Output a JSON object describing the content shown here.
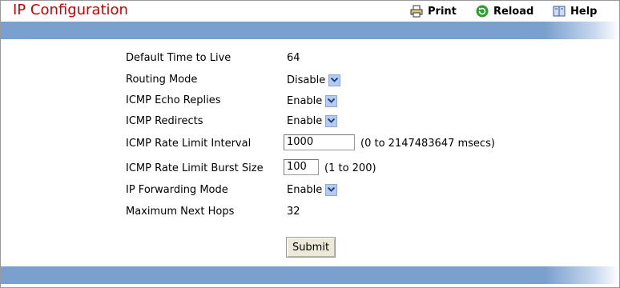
{
  "header": {
    "title": "IP Configuration",
    "print_label": "Print",
    "reload_label": "Reload",
    "help_label": "Help",
    "icons": {
      "print": "printer-icon",
      "reload": "reload-icon",
      "help": "help-book-icon"
    },
    "colors": {
      "title": "#cc0000",
      "band": "#7aa0cf"
    }
  },
  "form": {
    "default_ttl": {
      "label": "Default Time to Live",
      "value": "64"
    },
    "routing_mode": {
      "label": "Routing Mode",
      "value": "Disable"
    },
    "icmp_echo": {
      "label": "ICMP Echo Replies",
      "value": "Enable"
    },
    "icmp_redirects": {
      "label": "ICMP Redirects",
      "value": "Enable"
    },
    "icmp_rate_interval": {
      "label": "ICMP Rate Limit Interval",
      "value": "1000",
      "hint": "(0 to 2147483647 msecs)"
    },
    "icmp_rate_burst": {
      "label": "ICMP Rate Limit Burst Size",
      "value": "100",
      "hint": "(1 to 200)"
    },
    "ip_forwarding": {
      "label": "IP Forwarding Mode",
      "value": "Enable"
    },
    "max_next_hops": {
      "label": "Maximum Next Hops",
      "value": "32"
    },
    "submit_label": "Submit"
  }
}
